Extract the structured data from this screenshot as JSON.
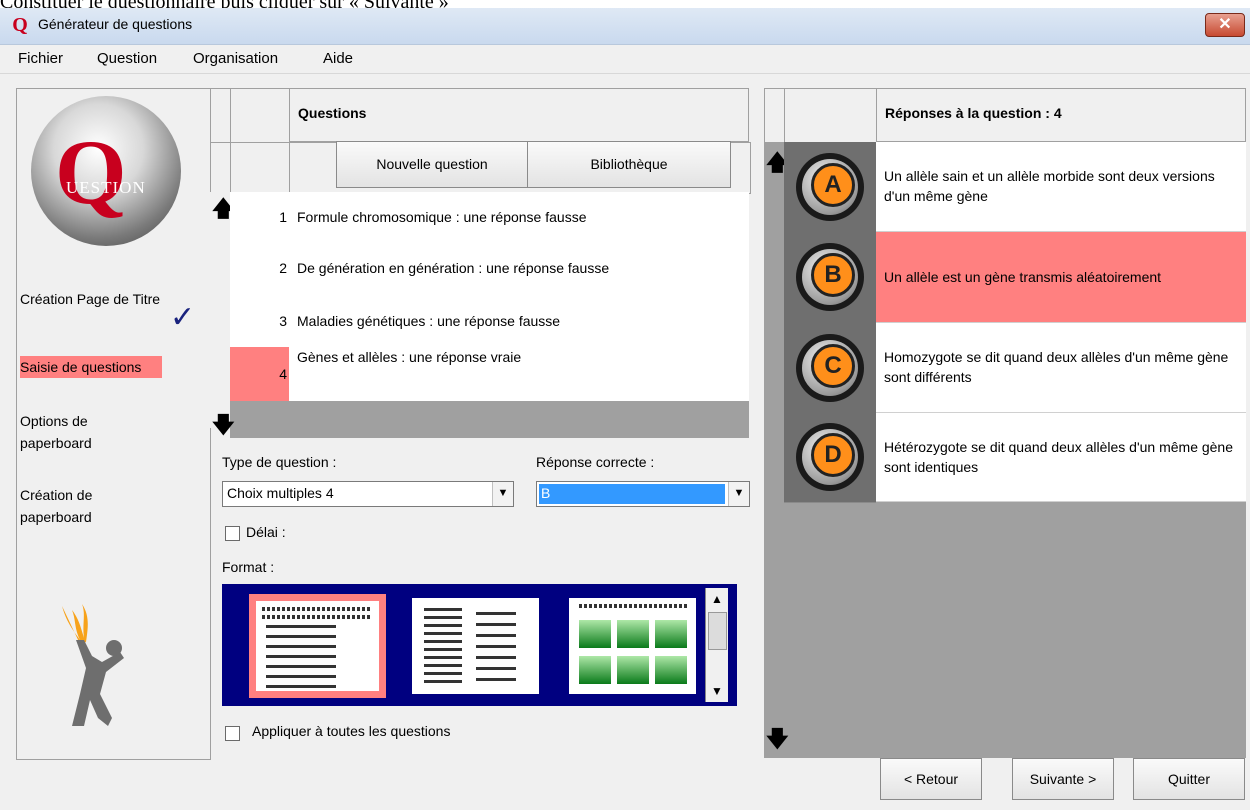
{
  "document": {
    "text": "Constituer le questionnaire puis cliquer sur « Suivante »"
  },
  "window": {
    "title": "Générateur de questions",
    "close_symbol": "✕"
  },
  "menu": [
    "Fichier",
    "Question",
    "Organisation",
    "Aide"
  ],
  "logo": {
    "letter": "Q",
    "word": "UESTION"
  },
  "steps": [
    {
      "label": "Création Page de Titre",
      "done": true
    },
    {
      "label": "Saisie de questions",
      "active": true
    },
    {
      "label": "Options de paperboard"
    },
    {
      "label": "Création de paperboard"
    }
  ],
  "questions_panel": {
    "header": "Questions",
    "new_question_button": "Nouvelle question",
    "library_button": "Bibliothèque",
    "rows": [
      {
        "num": "1",
        "text": "Formule chromosomique : une réponse fausse"
      },
      {
        "num": "2",
        "text": "De génération en génération : une réponse fausse"
      },
      {
        "num": "3",
        "text": "Maladies génétiques : une réponse fausse"
      },
      {
        "num": "4",
        "text": "Gènes et allèles : une réponse vraie",
        "selected": true
      }
    ]
  },
  "form": {
    "type_label": "Type de question :",
    "type_value": "Choix multiples 4",
    "correct_label": "Réponse correcte :",
    "correct_value": "B",
    "delay_label": "Délai :",
    "format_label": "Format :",
    "apply_all_label": "Appliquer à toutes les questions"
  },
  "answers_panel": {
    "header": "Réponses à la question : 4",
    "answers": [
      {
        "letter": "A",
        "text": "Un allèle sain et un allèle morbide sont deux versions d'un même gène"
      },
      {
        "letter": "B",
        "text": "Un allèle est un gène transmis aléatoirement",
        "highlighted": true
      },
      {
        "letter": "C",
        "text": "Homozygote se dit quand deux allèles d'un même gène sont différents"
      },
      {
        "letter": "D",
        "text": "Hétérozygote se dit quand deux allèles d'un même gène sont identiques"
      }
    ]
  },
  "footer": {
    "back": "< Retour",
    "next": "Suivante >",
    "quit": "Quitter"
  },
  "colors": {
    "highlight": "#ff8080",
    "selected_blue": "#3399ff",
    "format_bg": "#000080"
  }
}
